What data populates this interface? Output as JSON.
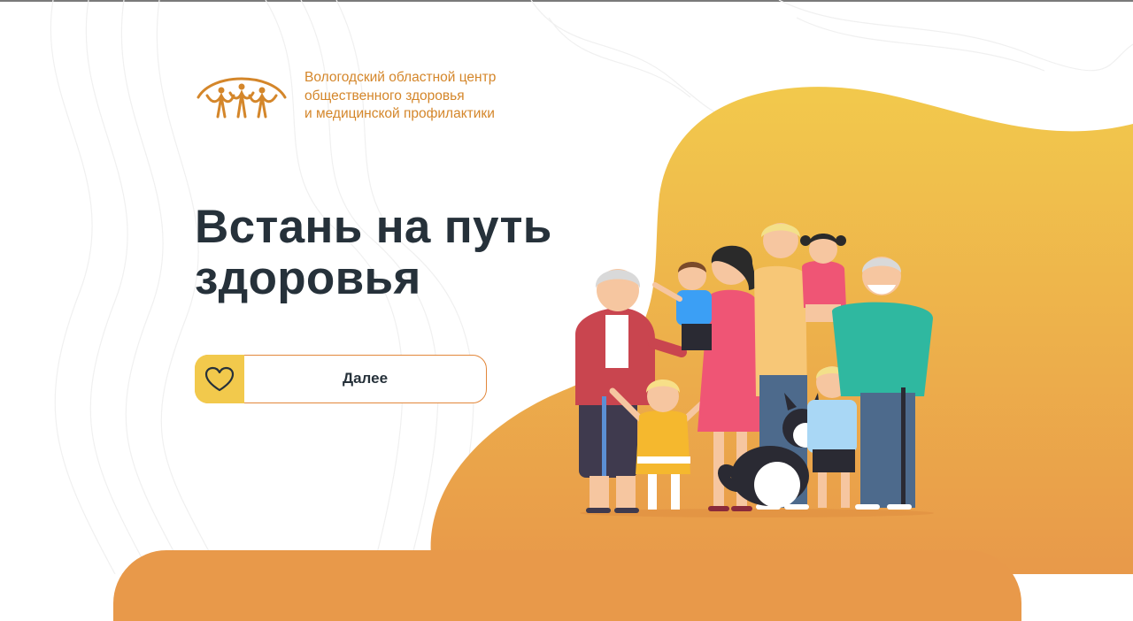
{
  "org": {
    "line1": "Вологодский областной центр",
    "line2": "общественного здоровья",
    "line3": "и медицинской профилактики",
    "logo_icon": "people-arc-logo"
  },
  "hero": {
    "headline_line1": "Встань на путь",
    "headline_line2": "здоровья"
  },
  "cta": {
    "label": "Далее",
    "icon": "heart-icon"
  },
  "illustration": {
    "subject": "family-illustration"
  },
  "colors": {
    "accent": "#e2873a",
    "gradient_top": "#f2c94c",
    "gradient_bottom": "#e8994a",
    "text_dark": "#26313a",
    "logo": "#d4862a"
  }
}
